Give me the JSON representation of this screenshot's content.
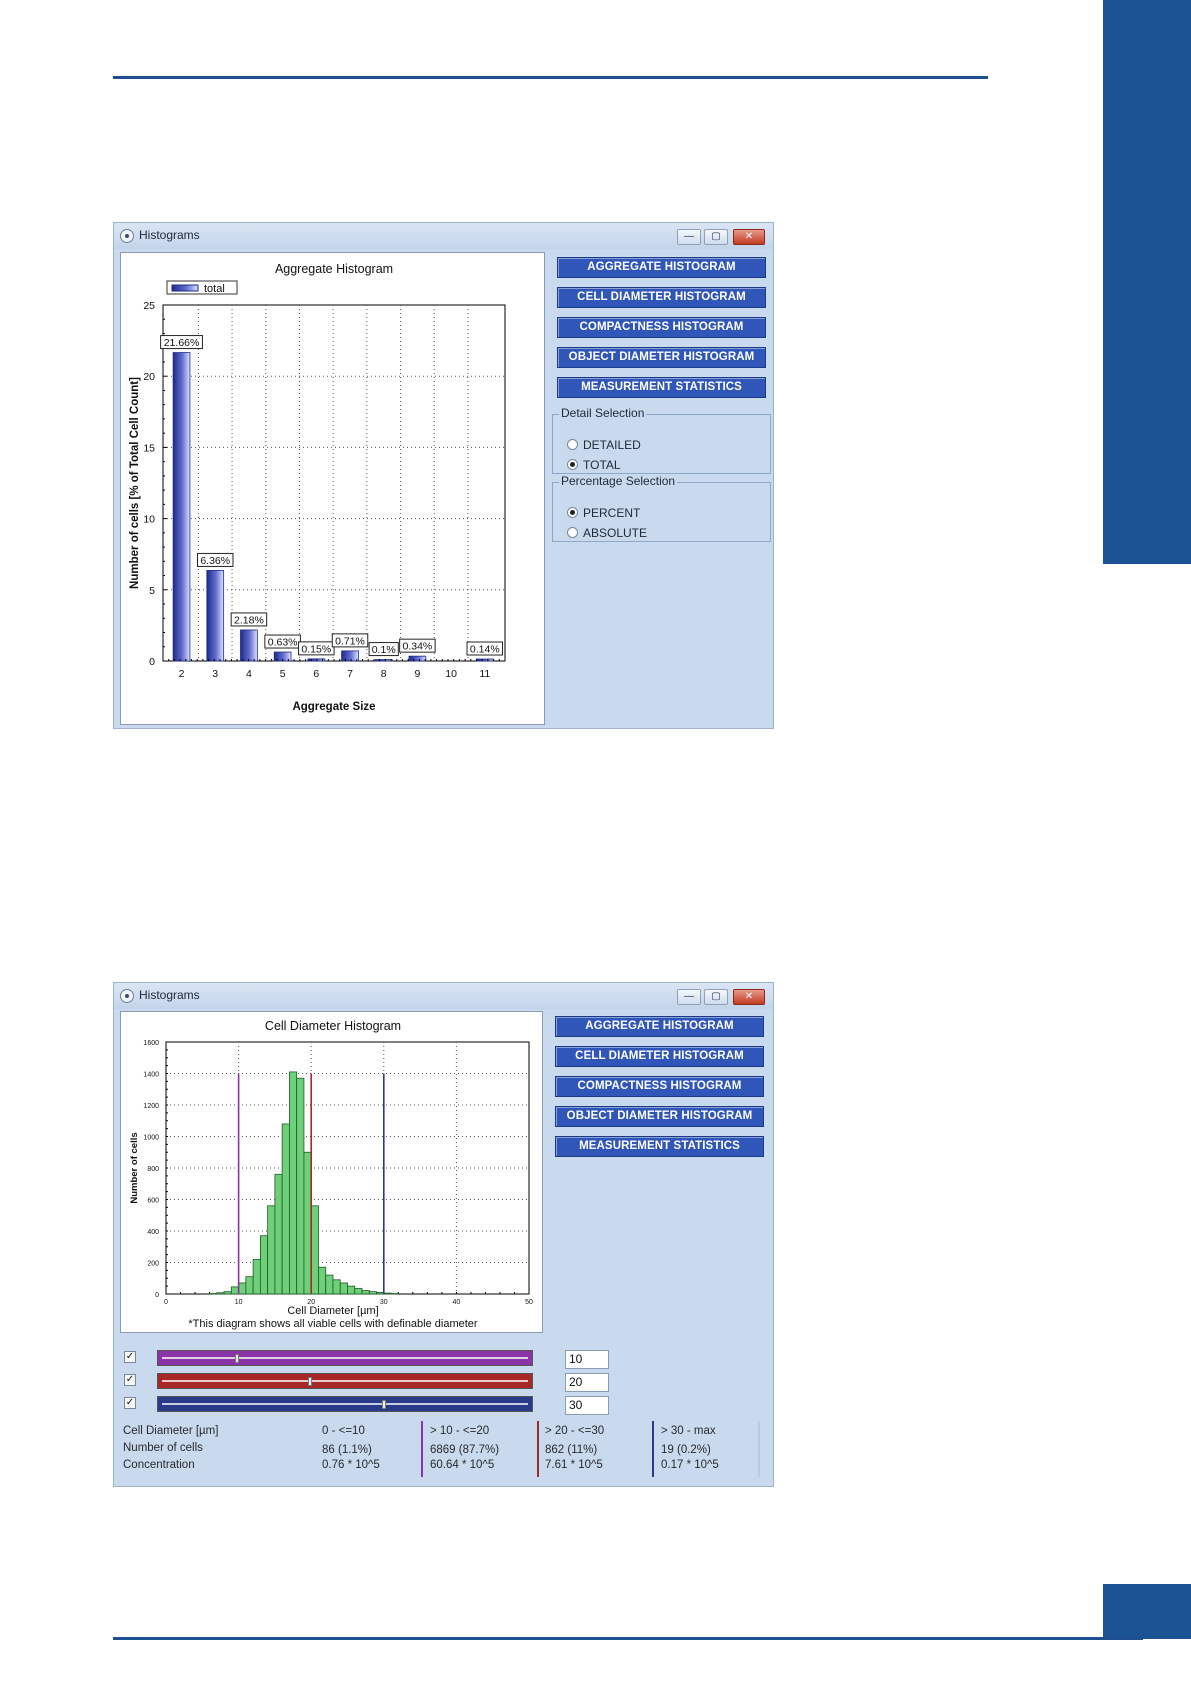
{
  "window1": {
    "title": "Histograms",
    "minimize": "—",
    "maximize": "▢",
    "close": "✕",
    "buttons": [
      "AGGREGATE HISTOGRAM",
      "CELL DIAMETER HISTOGRAM",
      "COMPACTNESS HISTOGRAM",
      "OBJECT DIAMETER HISTOGRAM",
      "MEASUREMENT STATISTICS"
    ],
    "detail_selection": {
      "label": "Detail Selection",
      "options": [
        "DETAILED",
        "TOTAL"
      ],
      "selected": "TOTAL"
    },
    "percentage_selection": {
      "label": "Percentage Selection",
      "options": [
        "PERCENT",
        "ABSOLUTE"
      ],
      "selected": "PERCENT"
    }
  },
  "window2": {
    "title": "Histograms",
    "minimize": "—",
    "maximize": "▢",
    "close": "✕",
    "buttons": [
      "AGGREGATE HISTOGRAM",
      "CELL DIAMETER HISTOGRAM",
      "COMPACTNESS HISTOGRAM",
      "OBJECT DIAMETER HISTOGRAM",
      "MEASUREMENT STATISTICS"
    ],
    "sliders": [
      {
        "checked": "✓",
        "value": "10",
        "color": "#8a34a8"
      },
      {
        "checked": "✓",
        "value": "20",
        "color": "#a82828"
      },
      {
        "checked": "✓",
        "value": "30",
        "color": "#2a3a8a"
      }
    ],
    "stats": {
      "row_labels": [
        "Cell Diameter [µm]",
        "Number of cells",
        "Concentration"
      ],
      "columns": [
        {
          "range": "0 - <=10",
          "count": "86  (1.1%)",
          "conc": "0.76 * 10^5",
          "color": "#8a34a8"
        },
        {
          "range": "> 10 - <=20",
          "count": "6869  (87.7%)",
          "conc": "60.64 * 10^5",
          "color": "#a82828"
        },
        {
          "range": "> 20 - <=30",
          "count": "862  (11%)",
          "conc": "7.61 * 10^5",
          "color": "#2a3a8a"
        },
        {
          "range": "> 30 - max",
          "count": "19  (0.2%)",
          "conc": "0.17 * 10^5",
          "color": "#b9cbe4"
        }
      ]
    }
  },
  "chart_data": [
    {
      "type": "bar",
      "title": "Aggregate Histogram",
      "xlabel": "Aggregate Size",
      "ylabel": "Number of cells [% of Total Cell Count]",
      "legend": "total",
      "legend_position": "top-left",
      "grid": true,
      "categories": [
        "2",
        "3",
        "4",
        "5",
        "6",
        "7",
        "8",
        "9",
        "10",
        "11"
      ],
      "values": [
        21.66,
        6.36,
        2.18,
        0.63,
        0.15,
        0.71,
        0.1,
        0.34,
        0,
        0.14
      ],
      "data_labels": [
        "21.66%",
        "6.36%",
        "2.18%",
        "0.63%",
        "0.15%",
        "0.71%",
        "0.1%",
        "0.34%",
        "",
        "0.14%"
      ],
      "yticks": [
        "0",
        "5",
        "10",
        "15",
        "20",
        "25"
      ],
      "ylim": [
        0,
        25
      ]
    },
    {
      "type": "bar",
      "title": "Cell Diameter Histogram",
      "xlabel": "Cell Diameter [µm]",
      "ylabel": "Number of cells",
      "note": "*This diagram shows all viable cells with definable diameter",
      "grid": true,
      "xlim": [
        0,
        50
      ],
      "ylim": [
        0,
        1600
      ],
      "xticks": [
        "0",
        "10",
        "20",
        "30",
        "40",
        "50"
      ],
      "yticks": [
        "0",
        "200",
        "400",
        "600",
        "800",
        "1000",
        "1200",
        "1400",
        "1600"
      ],
      "bin_width": 1,
      "bin_starts": [
        6,
        7,
        8,
        9,
        10,
        11,
        12,
        13,
        14,
        15,
        16,
        17,
        18,
        19,
        20,
        21,
        22,
        23,
        24,
        25,
        26,
        27,
        28,
        29,
        30,
        31
      ],
      "values": [
        3,
        8,
        15,
        45,
        70,
        110,
        220,
        370,
        560,
        760,
        1080,
        1410,
        1370,
        900,
        560,
        170,
        120,
        90,
        70,
        50,
        35,
        22,
        15,
        10,
        6,
        3
      ],
      "markers": [
        10,
        20,
        30
      ],
      "marker_colors": [
        "#8a34a8",
        "#a82828",
        "#2a3a8a"
      ]
    }
  ]
}
